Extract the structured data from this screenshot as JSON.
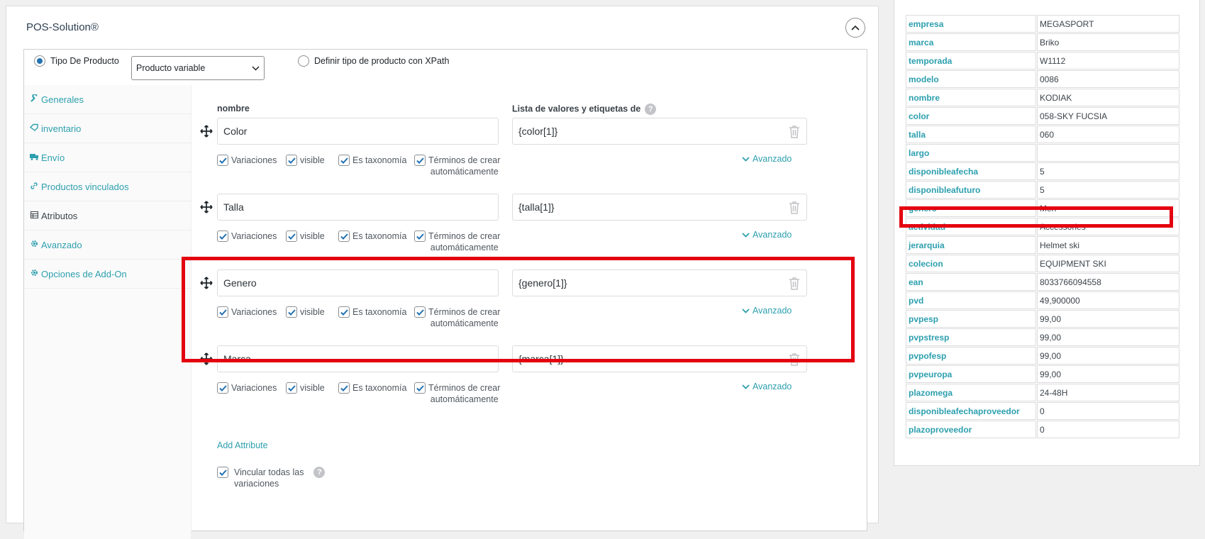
{
  "panel": {
    "title": "POS-Solution®"
  },
  "product_type": {
    "radio_label": "Tipo De Producto",
    "selected": "Producto variable",
    "xpath_label": "Definir tipo de producto con XPath"
  },
  "tabs": [
    {
      "label": "Generales",
      "icon": "wrench-icon"
    },
    {
      "label": "inventario",
      "icon": "tag-icon"
    },
    {
      "label": "Envío",
      "icon": "truck-icon"
    },
    {
      "label": "Productos vinculados",
      "icon": "link-icon"
    },
    {
      "label": "Atributos",
      "icon": "table-icon"
    },
    {
      "label": "Avanzado",
      "icon": "gear-icon"
    },
    {
      "label": "Opciones de Add-On",
      "icon": "gear-icon"
    }
  ],
  "columns": {
    "name": "nombre",
    "values": "Lista de valores y etiquetas de"
  },
  "options": {
    "variations": "Variaciones",
    "visible": "visible",
    "taxonomy": "Es taxonomía",
    "terms_line1": "Términos de crear",
    "terms_line2": "automáticamente",
    "advanced": "Avanzado"
  },
  "attributes": [
    {
      "name": "Color",
      "value": "{color[1]}"
    },
    {
      "name": "Talla",
      "value": "{talla[1]}"
    },
    {
      "name": "Genero",
      "value": "{genero[1]}"
    },
    {
      "name": "Marca",
      "value": "{marca[1]}"
    }
  ],
  "add_attribute": "Add Attribute",
  "link_all": {
    "line1": "Vincular todas las",
    "line2": "variaciones"
  },
  "fields": [
    {
      "key": "empresa",
      "value": "MEGASPORT"
    },
    {
      "key": "marca",
      "value": "Briko"
    },
    {
      "key": "temporada",
      "value": "W1112"
    },
    {
      "key": "modelo",
      "value": "0086"
    },
    {
      "key": "nombre",
      "value": "KODIAK"
    },
    {
      "key": "color",
      "value": "058-SKY FUCSIA"
    },
    {
      "key": "talla",
      "value": "060"
    },
    {
      "key": "largo",
      "value": ""
    },
    {
      "key": "disponibleafecha",
      "value": "5"
    },
    {
      "key": "disponibleafuturo",
      "value": "5"
    },
    {
      "key": "genero",
      "value": "Men"
    },
    {
      "key": "actividad",
      "value": "Accessories"
    },
    {
      "key": "jerarquia",
      "value": "Helmet ski"
    },
    {
      "key": "colecion",
      "value": "EQUIPMENT SKI"
    },
    {
      "key": "ean",
      "value": "8033766094558"
    },
    {
      "key": "pvd",
      "value": "49,900000"
    },
    {
      "key": "pvpesp",
      "value": "99,00"
    },
    {
      "key": "pvpstresp",
      "value": "99,00"
    },
    {
      "key": "pvpofesp",
      "value": "99,00"
    },
    {
      "key": "pvpeuropa",
      "value": "99,00"
    },
    {
      "key": "plazomega",
      "value": "24-48H"
    },
    {
      "key": "disponibleafechaproveedor",
      "value": "0"
    },
    {
      "key": "plazoproveedor",
      "value": "0"
    }
  ],
  "colors": {
    "accent": "#2c9fae",
    "highlight": "#e3000f",
    "checkbox": "#2271b1"
  }
}
